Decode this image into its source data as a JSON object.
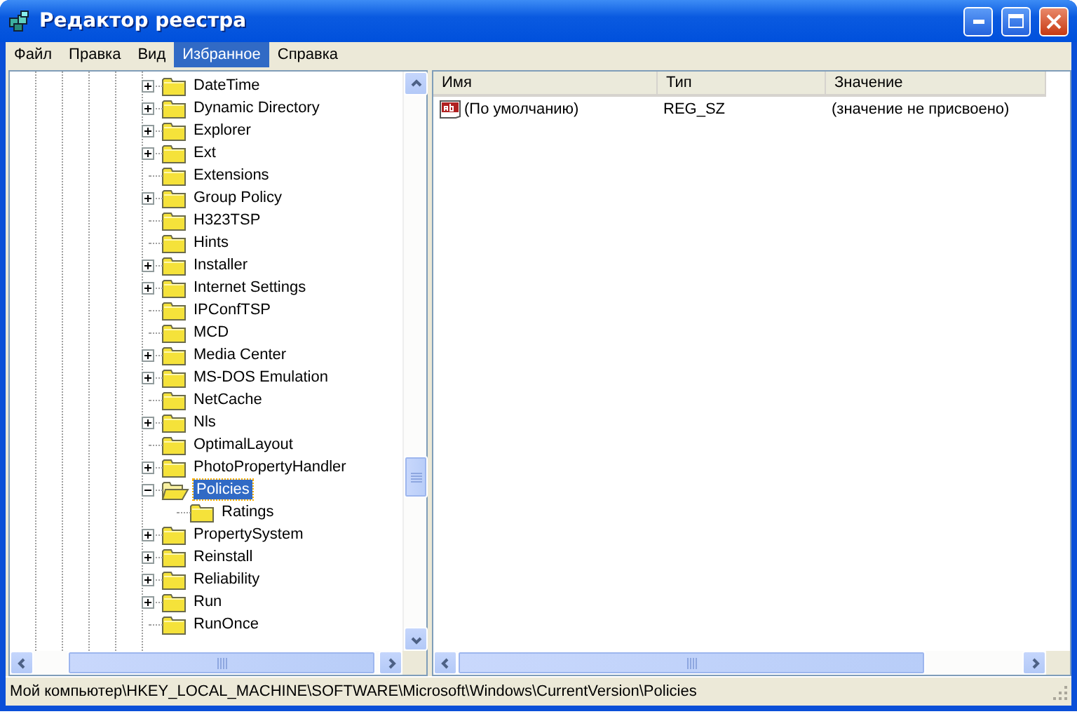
{
  "window": {
    "title": "Редактор реестра"
  },
  "menu": [
    {
      "label": "Файл",
      "selected": false
    },
    {
      "label": "Правка",
      "selected": false
    },
    {
      "label": "Вид",
      "selected": false
    },
    {
      "label": "Избранное",
      "selected": true
    },
    {
      "label": "Справка",
      "selected": false
    }
  ],
  "tree": [
    {
      "label": "DateTime",
      "expandable": true,
      "expanded": false,
      "selected": false
    },
    {
      "label": "Dynamic Directory",
      "expandable": true,
      "expanded": false,
      "selected": false
    },
    {
      "label": "Explorer",
      "expandable": true,
      "expanded": false,
      "selected": false
    },
    {
      "label": "Ext",
      "expandable": true,
      "expanded": false,
      "selected": false
    },
    {
      "label": "Extensions",
      "expandable": false,
      "selected": false
    },
    {
      "label": "Group Policy",
      "expandable": true,
      "expanded": false,
      "selected": false
    },
    {
      "label": "H323TSP",
      "expandable": false,
      "selected": false
    },
    {
      "label": "Hints",
      "expandable": false,
      "selected": false
    },
    {
      "label": "Installer",
      "expandable": true,
      "expanded": false,
      "selected": false
    },
    {
      "label": "Internet Settings",
      "expandable": true,
      "expanded": false,
      "selected": false
    },
    {
      "label": "IPConfTSP",
      "expandable": false,
      "selected": false
    },
    {
      "label": "MCD",
      "expandable": false,
      "selected": false
    },
    {
      "label": "Media Center",
      "expandable": true,
      "expanded": false,
      "selected": false
    },
    {
      "label": "MS-DOS Emulation",
      "expandable": true,
      "expanded": false,
      "selected": false
    },
    {
      "label": "NetCache",
      "expandable": false,
      "selected": false
    },
    {
      "label": "Nls",
      "expandable": true,
      "expanded": false,
      "selected": false
    },
    {
      "label": "OptimalLayout",
      "expandable": false,
      "selected": false
    },
    {
      "label": "PhotoPropertyHandler",
      "expandable": true,
      "expanded": false,
      "selected": false
    },
    {
      "label": "Policies",
      "expandable": true,
      "expanded": true,
      "selected": true,
      "children": [
        {
          "label": "Ratings",
          "expandable": false,
          "selected": false
        }
      ]
    },
    {
      "label": "PropertySystem",
      "expandable": true,
      "expanded": false,
      "selected": false
    },
    {
      "label": "Reinstall",
      "expandable": true,
      "expanded": false,
      "selected": false
    },
    {
      "label": "Reliability",
      "expandable": true,
      "expanded": false,
      "selected": false
    },
    {
      "label": "Run",
      "expandable": true,
      "expanded": false,
      "selected": false
    },
    {
      "label": "RunOnce",
      "expandable": false,
      "selected": false
    }
  ],
  "values": {
    "columns": [
      "Имя",
      "Тип",
      "Значение"
    ],
    "rows": [
      {
        "name": "(По умолчанию)",
        "type": "REG_SZ",
        "data": "(значение не присвоено)"
      }
    ]
  },
  "status_bar": "Мой компьютер\\HKEY_LOCAL_MACHINE\\SOFTWARE\\Microsoft\\Windows\\CurrentVersion\\Policies"
}
